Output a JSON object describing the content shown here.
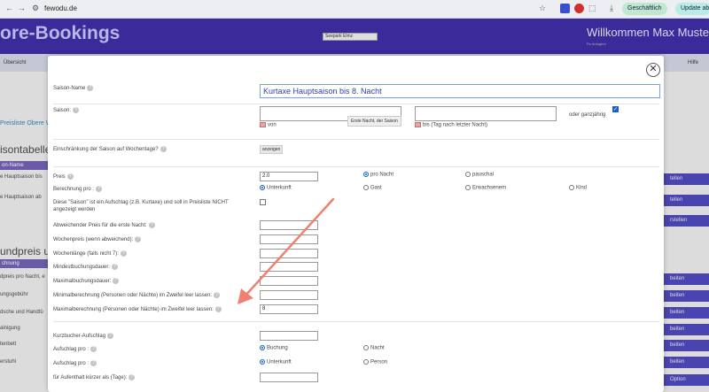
{
  "browser": {
    "url": "fewodu.de",
    "profile_label": "Geschäftlich",
    "update_label": "Update abschließen"
  },
  "site": {
    "brand": "ore-Bookings",
    "season_select": "Seepark Elmz",
    "welcome": "Willkommen Max Muster",
    "welcome_sub": "Pn Anlegent",
    "nav_left": "Übersicht",
    "nav_right": "Hilfe",
    "left": {
      "link": "Preisliste Obere W",
      "saison_title": "isontabelle",
      "saison_header": "on-Name",
      "saison_items": [
        "e Hauptsaison bis",
        "e Hauptsaison ab"
      ],
      "grundpreis_title": "undpreis u",
      "grundpreis_header": "chnung",
      "grundpreis_items": [
        "dpreis pro Nacht, e",
        "ungsgebühr",
        "dsche und Handtü",
        "ainigung",
        "tenbett",
        "erstuhl"
      ]
    },
    "right_buttons": [
      "tellen",
      "tellen",
      "rstellen",
      "beiten",
      "beiten",
      "beiten",
      "beiten",
      "beiten",
      "beiten",
      "Option"
    ]
  },
  "modal": {
    "close_label": "✕",
    "saison_name_label": "Saison-Name",
    "saison_name_value": "Kurtaxe Hauptsaison bis 8. Nacht",
    "saison_label": "Saison:",
    "tooltip": "Erste Nacht, der Saison",
    "von_label": "von",
    "bis_label": "bis (Tag nach letzter Nacht)",
    "ganzjaehrig_label": "oder ganzjährig",
    "wochentage_label": "Einschränkung der Saison auf Wochentage?",
    "wochentage_button": "anzeigen",
    "preis_label": "Preis",
    "preis_value": "2.0",
    "pro_nacht": "pro Nacht",
    "pauschal": "pauschal",
    "berechnung_label": "Berechnung pro :",
    "unterkunft": "Unterkunft",
    "gast": "Gast",
    "erwachsenem": "Erwachsenem",
    "kind": "Kind",
    "aufschlag_note_1": "Diese \"Saison\" ist ein Aufschlag (z.B. Kurtaxe) und soll in Preisliste NICHT",
    "aufschlag_note_2": "angezeigt werden",
    "abweichender_preis": "Abweichender Preis für die erste Nacht:",
    "wochenpreis": "Wochenpreis (wenn abweichend):",
    "wochenlaenge": "Wochenlänge (falls nicht 7):",
    "mindestbuchungsdauer": "Mindestbuchungsdauer:",
    "maximalbuchungsdauer": "Maximalbuchungsdauer:",
    "minimalberechnung": "Minimalberechnung (Personen oder Nächte) im Zweifel leer lassen:",
    "maximalberechnung": "Maximalberechnung (Personen oder Nächte) im Zweifel leer lassen:",
    "maximalberechnung_value": "8",
    "kurzbucher_label": "Kurzbucher-Aufschlag",
    "aufschlag_pro_1": "Aufschlag pro :",
    "buchung": "Buchung",
    "nacht": "Nacht",
    "aufschlag_pro_2": "Aufschlag pro :",
    "unterkunft2": "Unterkunft",
    "person": "Person",
    "aufenthalt_label": "für Aufenthalt kürzer als (Tage):",
    "help_glyph": "?"
  },
  "colors": {
    "header_bg": "#3a2a9a",
    "accent_blue": "#1a5fd0",
    "arrow": "#f08070"
  }
}
